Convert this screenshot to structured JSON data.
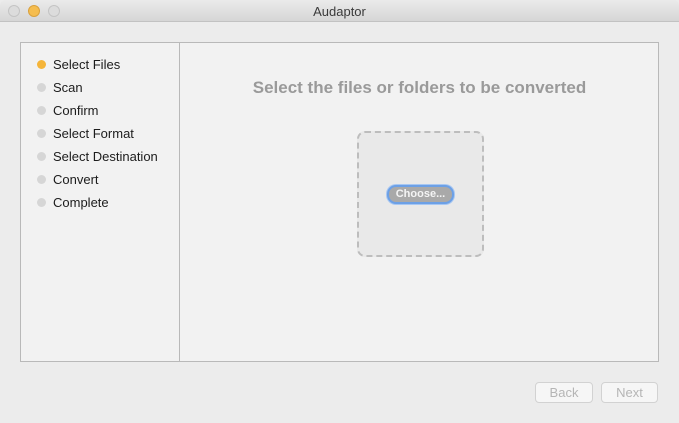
{
  "window": {
    "title": "Audaptor",
    "colors": {
      "active_step": "#f5b53a",
      "inactive_step": "#d6d6d6",
      "focus_ring": "#6ca0e6"
    }
  },
  "sidebar": {
    "steps": [
      {
        "label": "Select Files",
        "active": true
      },
      {
        "label": "Scan",
        "active": false
      },
      {
        "label": "Confirm",
        "active": false
      },
      {
        "label": "Select Format",
        "active": false
      },
      {
        "label": "Select Destination",
        "active": false
      },
      {
        "label": "Convert",
        "active": false
      },
      {
        "label": "Complete",
        "active": false
      }
    ]
  },
  "main": {
    "heading": "Select the files or folders to be converted",
    "choose_label": "Choose..."
  },
  "footer": {
    "back_label": "Back",
    "next_label": "Next"
  }
}
